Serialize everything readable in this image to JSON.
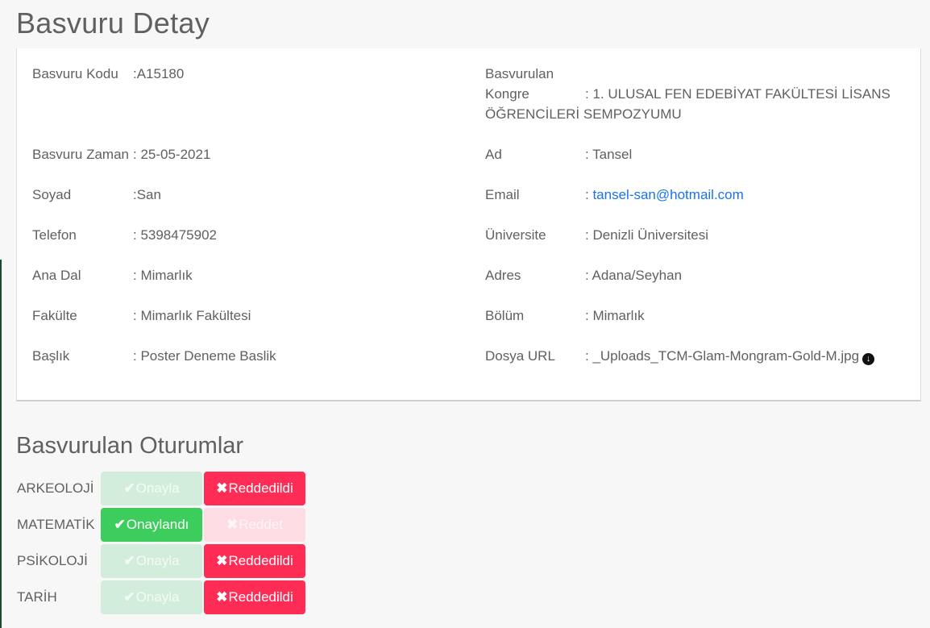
{
  "page_title": "Basvuru Detay",
  "left_fields": [
    {
      "label": "Basvuru Kodu",
      "value": ":A15180"
    },
    {
      "label": "Basvuru Zaman",
      "value": ": 25-05-2021"
    },
    {
      "label": "Soyad",
      "value": ":San"
    },
    {
      "label": "Telefon",
      "value": ": 5398475902"
    },
    {
      "label": "Ana Dal",
      "value": ": Mimarlık"
    },
    {
      "label": "Fakülte",
      "value": ": Mimarlık Fakültesi"
    },
    {
      "label": "Başlık",
      "value": ": Poster Deneme Baslik"
    }
  ],
  "congress": {
    "label_line1": "Basvurulan",
    "label_line2": "Kongre",
    "value_line1": ": 1. ULUSAL FEN EDEBİYAT FAKÜLTESİ LİSANS",
    "value_line2": "ÖĞRENCİLERİ SEMPOZYUMU"
  },
  "right_fields": {
    "ad": {
      "label": "Ad",
      "value": ": Tansel"
    },
    "email": {
      "label": "Email",
      "prefix": ": ",
      "value": "tansel-san@hotmail.com"
    },
    "universite": {
      "label": "Üniversite",
      "value": ": Denizli Üniversitesi"
    },
    "adres": {
      "label": "Adres",
      "value": ": Adana/Seyhan"
    },
    "bolum": {
      "label": "Bölüm",
      "value": ": Mimarlık"
    },
    "dosya": {
      "label": "Dosya URL",
      "value": ": _Uploads_TCM-Glam-Mongram-Gold-M.jpg",
      "icon": "download-icon"
    }
  },
  "sessions_title": "Basvurulan Oturumlar",
  "sessions": [
    {
      "name": "ARKEOLOJİ",
      "approve_label": "Onayla",
      "reject_label": "Reddedildi",
      "approve_state": "faded",
      "reject_state": "active"
    },
    {
      "name": "MATEMATİK",
      "approve_label": "Onaylandı",
      "reject_label": "Reddet",
      "approve_state": "active",
      "reject_state": "faded"
    },
    {
      "name": "PSİKOLOJİ",
      "approve_label": "Onayla",
      "reject_label": "Reddedildi",
      "approve_state": "faded",
      "reject_state": "active"
    },
    {
      "name": "TARİH",
      "approve_label": "Onayla",
      "reject_label": "Reddedildi",
      "approve_state": "faded",
      "reject_state": "active"
    }
  ],
  "icons": {
    "approve": "check-icon",
    "reject": "cross-icon"
  },
  "colors": {
    "approve_active": "#3dcd5d",
    "reject_active": "#ff2d55",
    "link": "#1a73e8"
  }
}
